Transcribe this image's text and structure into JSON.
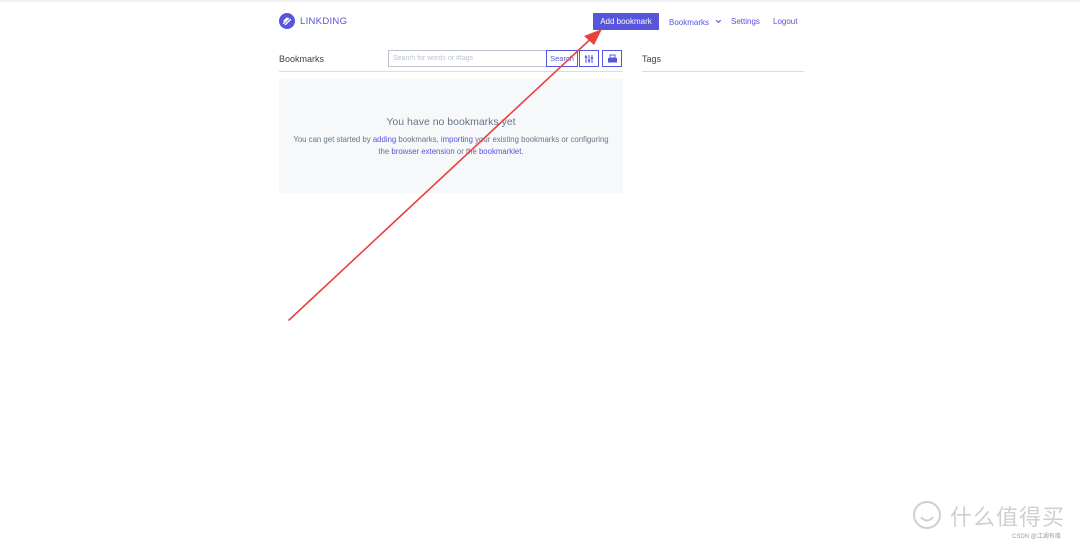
{
  "app": {
    "name": "LINKDING"
  },
  "header": {
    "add_bookmark": "Add bookmark",
    "nav": {
      "bookmarks": "Bookmarks",
      "settings": "Settings",
      "logout": "Logout"
    }
  },
  "bookmarks": {
    "title": "Bookmarks",
    "search_placeholder": "Search for words or #tags",
    "search_button": "Search",
    "empty": {
      "title": "You have no bookmarks yet",
      "t1": "You can get started by ",
      "link_adding": "adding",
      "t2": " bookmarks, ",
      "link_importing": "importing",
      "t3": " your existing bookmarks or configuring the ",
      "link_extension": "browser extension",
      "t4": " or the ",
      "link_bookmarklet": "bookmarklet",
      "t5": "."
    }
  },
  "tags": {
    "title": "Tags"
  },
  "watermark": {
    "main": "什么值得买",
    "sub": "CSDN @江湖有缘"
  },
  "colors": {
    "accent": "#5755d9",
    "annotation_arrow": "#e8423f"
  }
}
